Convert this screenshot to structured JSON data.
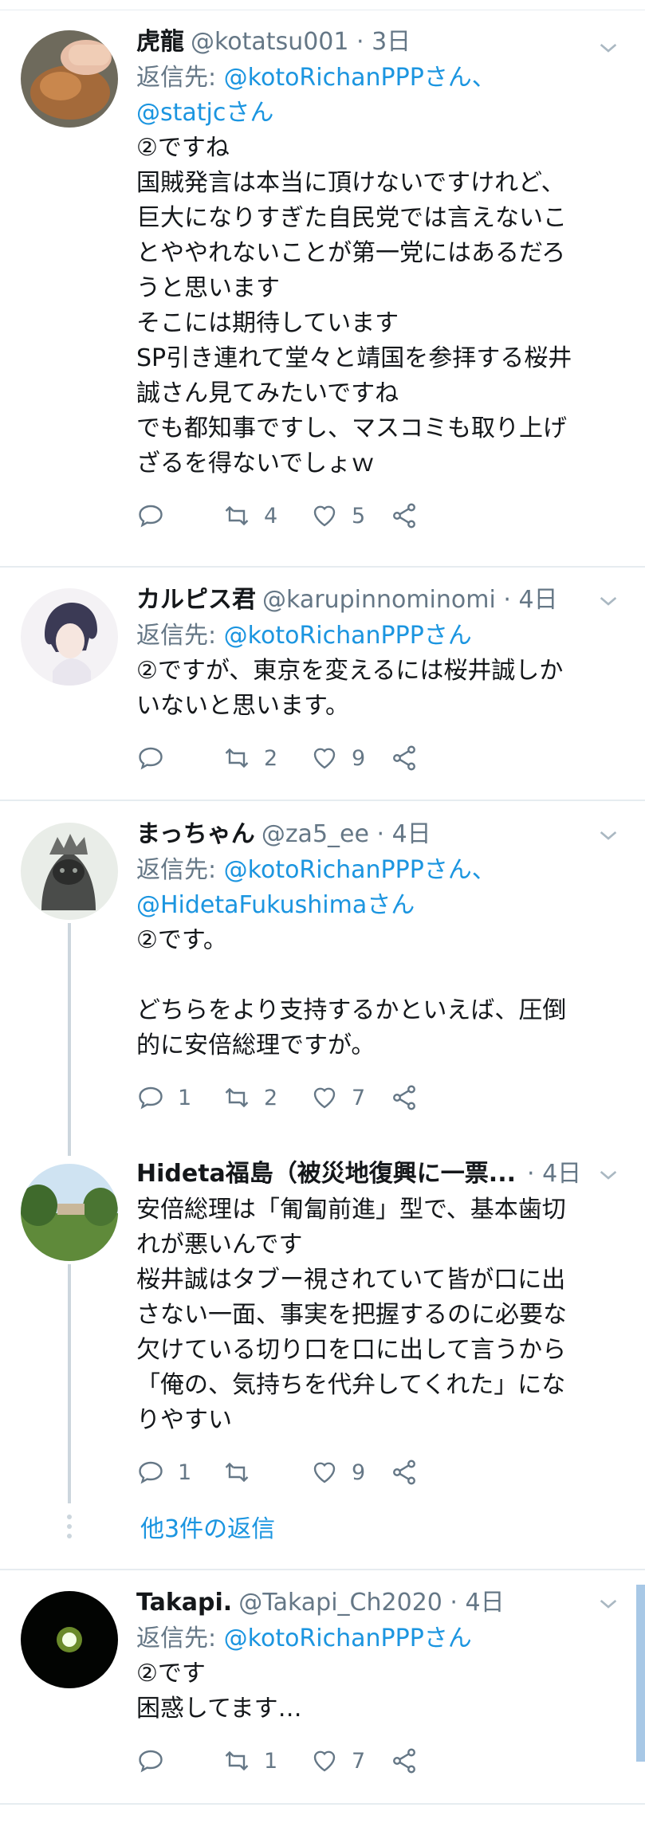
{
  "tweets": [
    {
      "name": "虎龍",
      "handle": "@kotatsu001",
      "time": "3日",
      "reply_prefix": "返信先: ",
      "reply_mentions": "@kotoRichanPPPさん、",
      "reply_mentions2": "@statjcさん",
      "body": "②ですね\n国賊発言は本当に頂けないですけれど、\n巨大になりすぎた自民党では言えないこ\nとややれないことが第一党にはあるだろ\nうと思います\nそこには期待しています\nSP引き連れて堂々と靖国を参拝する桜井\n誠さん見てみたいですね\nでも都知事ですし、マスコミも取り上げ\nざるを得ないでしょｗ",
      "replies": "",
      "retweets": "4",
      "likes": "5"
    },
    {
      "name": "カルピス君",
      "handle": "@karupinnominomi",
      "time": "4日",
      "reply_prefix": "返信先: ",
      "reply_mentions": "@kotoRichanPPPさん",
      "body": "②ですが、東京を変えるには桜井誠しか\nいないと思います。",
      "replies": "",
      "retweets": "2",
      "likes": "9"
    },
    {
      "name": "まっちゃん",
      "handle": "@za5_ee",
      "time": "4日",
      "reply_prefix": "返信先: ",
      "reply_mentions": "@kotoRichanPPPさん、",
      "reply_mentions2": "@HidetaFukushimaさん",
      "body": "②です。\n\nどちらをより支持するかといえば、圧倒\n的に安倍総理ですが。",
      "replies": "1",
      "retweets": "2",
      "likes": "7"
    },
    {
      "name": "Hideta福島（被災地復興に一票...",
      "handle": "",
      "time": "4日",
      "body": "安倍総理は「匍匐前進」型で、基本歯切\nれが悪いんです\n桜井誠はタブー視されていて皆が口に出\nさない一面、事実を把握するのに必要な\n欠けている切り口を口に出して言うから\n「俺の、気持ちを代弁してくれた」にな\nりやすい",
      "replies": "1",
      "retweets": "",
      "likes": "9"
    },
    {
      "name": "Takapi.",
      "handle": "@Takapi_Ch2020",
      "time": "4日",
      "reply_prefix": "返信先: ",
      "reply_mentions": "@kotoRichanPPPさん",
      "body": "②です\n困惑してます…",
      "replies": "",
      "retweets": "1",
      "likes": "7"
    }
  ],
  "more_replies_label": "他3件の返信",
  "separator_dot": " · ",
  "colors": {
    "link": "#1b95e0",
    "secondary": "#657786",
    "text": "#14171a",
    "divider": "#e6ecf0",
    "thread": "#ccd6dd"
  },
  "icons": [
    "reply-icon",
    "retweet-icon",
    "like-icon",
    "share-icon",
    "chevron-down-icon"
  ]
}
